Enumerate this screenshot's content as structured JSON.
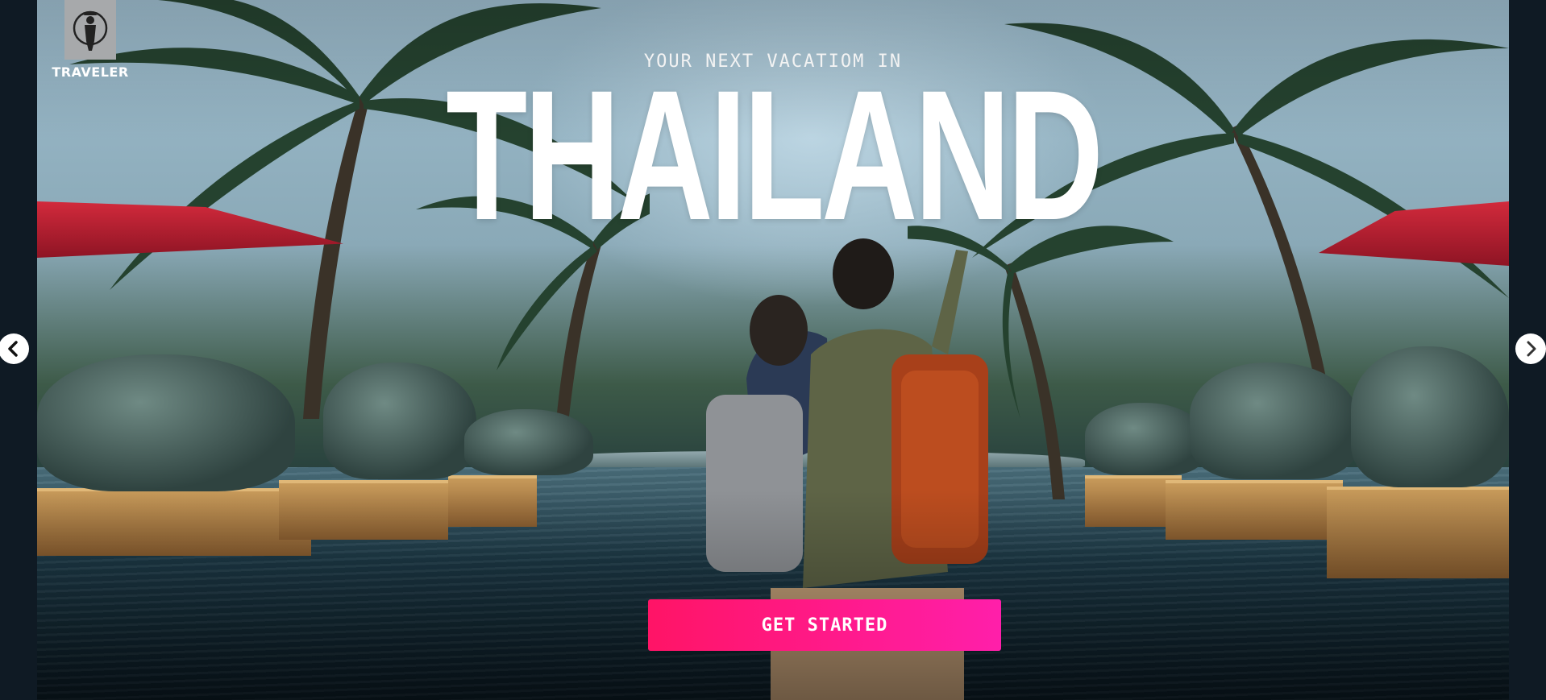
{
  "brand": {
    "name": "TRAVELER",
    "logo_icon": "traveler-logo-icon"
  },
  "hero": {
    "kicker": "YOUR NEXT VACATIOM IN",
    "destination": "THAILAND",
    "cta_label": "GET STARTED",
    "background_scene": "hero-photo"
  },
  "carousel": {
    "prev_icon": "chevron-left-icon",
    "next_icon": "chevron-right-icon"
  },
  "colors": {
    "cta_start": "#ff1466",
    "cta_end": "#ff1faa",
    "page_bg": "#0f1a24"
  }
}
